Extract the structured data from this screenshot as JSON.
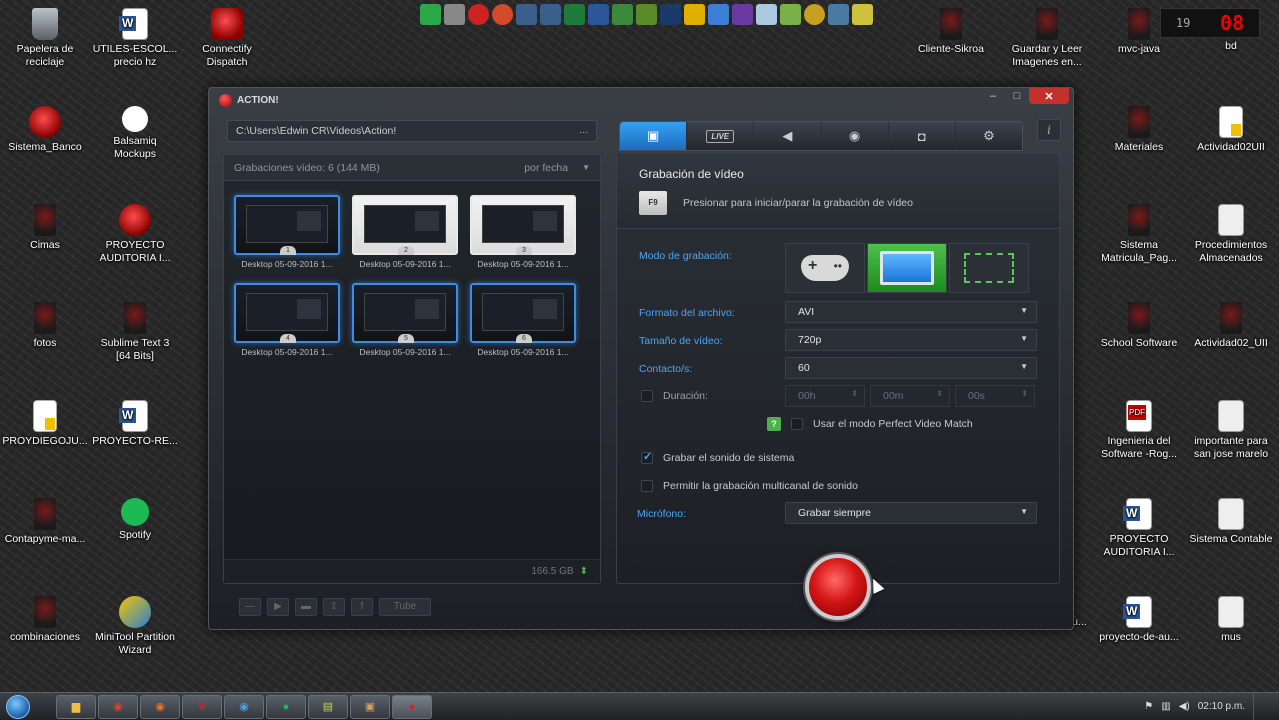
{
  "desktop_icons": [
    {
      "label": "Papelera de reciclaje",
      "icon": "recycle-bin-icon"
    },
    {
      "label": "UTILES-ESCOL... precio hz",
      "icon": "word-doc-icon"
    },
    {
      "label": "Connectify Dispatch",
      "icon": "connectify-icon"
    },
    {
      "label": "Sistema_Banco",
      "icon": "app-red-icon"
    },
    {
      "label": "Balsamiq Mockups",
      "icon": "balsamiq-icon"
    },
    {
      "label": "Cimas",
      "icon": "dark-app-icon"
    },
    {
      "label": "PROYECTO AUDITORIA I...",
      "icon": "app-red-icon"
    },
    {
      "label": "fotos",
      "icon": "dark-app-icon"
    },
    {
      "label": "Sublime Text 3 [64 Bits]",
      "icon": "dark-app-icon"
    },
    {
      "label": "PROYDIEGOJU...",
      "icon": "doc-icon"
    },
    {
      "label": "PROYECTO-RE...",
      "icon": "word-doc-icon"
    },
    {
      "label": "Contapyme-ma...",
      "icon": "dark-app-icon"
    },
    {
      "label": "Spotify",
      "icon": "spotify-icon"
    },
    {
      "label": "combinaciones",
      "icon": "dark-app-icon"
    },
    {
      "label": "MiniTool Partition Wizard",
      "icon": "minitool-icon"
    },
    {
      "label": "Cliente-Sikroa",
      "icon": "dark-app-icon"
    },
    {
      "label": "Guardar y Leer Imagenes en...",
      "icon": "dark-app-icon"
    },
    {
      "label": "mvc-java",
      "icon": "dark-app-icon"
    },
    {
      "label": "bd",
      "icon": "dark-app-icon"
    },
    {
      "label": "Materiales",
      "icon": "dark-app-icon"
    },
    {
      "label": "Actividad02UII",
      "icon": "doc-icon"
    },
    {
      "label": "Sistema Matricula_Pag...",
      "icon": "dark-app-icon"
    },
    {
      "label": "Procedimientos Almacenados",
      "icon": "pencil-doc-icon"
    },
    {
      "label": "School Software",
      "icon": "dark-app-icon"
    },
    {
      "label": "Actividad02_UII",
      "icon": "dark-app-icon"
    },
    {
      "label": "Ingenieria del Software -Rog...",
      "icon": "pdf-icon"
    },
    {
      "label": "importante para san jose marelo",
      "icon": "pencil-doc-icon"
    },
    {
      "label": "PROYECTO AUDITORIA I...",
      "icon": "word-doc-icon"
    },
    {
      "label": "Sistema Contable",
      "icon": "pencil-doc-icon"
    },
    {
      "label": "proyecto-de-au...",
      "icon": "dark-app-icon"
    },
    {
      "label": "proyecto-de-au...",
      "icon": "word-doc-icon"
    },
    {
      "label": "mus",
      "icon": "pencil-doc-icon"
    }
  ],
  "clock_widget": {
    "day_label": "19",
    "value": "08"
  },
  "window": {
    "title": "ACTION!",
    "path": "C:\\Users\\Edwin CR\\Videos\\Action!",
    "path_more": "...",
    "recordings_header": "Grabaciones vídeo: 6 (144 MB)",
    "sort_label": "por fecha",
    "thumbnails": [
      {
        "caption": "Desktop 05-09-2016 1...",
        "num": "1"
      },
      {
        "caption": "Desktop 05-09-2016 1...",
        "num": "2"
      },
      {
        "caption": "Desktop 05-09-2016 1...",
        "num": "3"
      },
      {
        "caption": "Desktop 05-09-2016 1...",
        "num": "4"
      },
      {
        "caption": "Desktop 05-09-2016 1...",
        "num": "5"
      },
      {
        "caption": "Desktop 05-09-2016 1...",
        "num": "6"
      }
    ],
    "disk_free": "166.5 GB",
    "youtube_label": "Tube",
    "tabs": [
      {
        "name": "video-record",
        "icon": "film-icon"
      },
      {
        "name": "live",
        "label": "LIVE"
      },
      {
        "name": "audio",
        "icon": "speaker-icon"
      },
      {
        "name": "benchmark",
        "icon": "stopwatch-icon"
      },
      {
        "name": "screenshot",
        "icon": "camera-icon"
      },
      {
        "name": "settings",
        "icon": "gear-icon"
      }
    ],
    "info_label": "i",
    "section_title": "Grabación de vídeo",
    "hotkey": "F9",
    "hotkey_desc": "Presionar para iniciar/parar la grabación de vídeo",
    "labels": {
      "mode": "Modo de grabación:",
      "format": "Formato del archivo:",
      "size": "Tamaño de vídeo:",
      "fps": "Contacto/s:",
      "duration": "Duración:",
      "perfect_match": "Usar el modo Perfect Video Match",
      "system_sound": "Grabar el sonido de sistema",
      "multichannel": "Permitir la grabación multicanal de sonido",
      "mic": "Micrófono:"
    },
    "values": {
      "format": "AVI",
      "size": "720p",
      "fps": "60",
      "dur_h": "00h",
      "dur_m": "00m",
      "dur_s": "00s",
      "mic": "Grabar siempre"
    },
    "checkboxes": {
      "duration": false,
      "perfect_match": false,
      "system_sound": true,
      "multichannel": false
    }
  },
  "taskbar": {
    "time": "02:10 p.m."
  }
}
